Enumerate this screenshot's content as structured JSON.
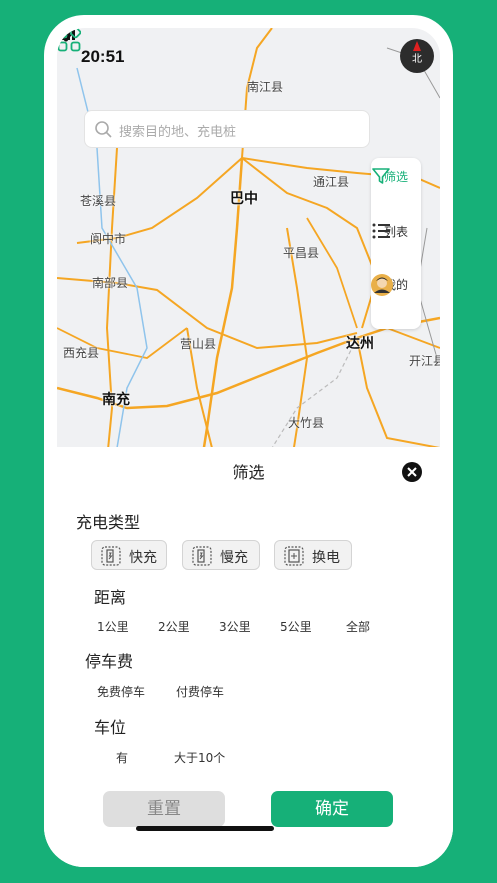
{
  "status_bar": {
    "time": "20:51"
  },
  "map": {
    "compass_label": "北",
    "places": {
      "nanjiang": "南江县",
      "cangxi": "苍溪县",
      "bazhong": "巴中",
      "tongjiang": "通江县",
      "langzhong": "阆中市",
      "pingchang": "平昌县",
      "nanbu": "南部县",
      "dazhou": "达州",
      "xichong": "西充县",
      "yingshan": "营山县",
      "kaijiang": "开江县",
      "nanchong": "南充",
      "dazhu": "大竹县"
    }
  },
  "search": {
    "placeholder": "搜索目的地、充电桩"
  },
  "side_panel": {
    "filter_label": "筛选",
    "list_label": "列表",
    "mine_label": "我的"
  },
  "filter_sheet": {
    "title": "筛选",
    "charge_type": {
      "title": "充电类型",
      "options": [
        "快充",
        "慢充",
        "换电"
      ]
    },
    "distance": {
      "title": "距离",
      "options": [
        "1公里",
        "2公里",
        "3公里",
        "5公里",
        "全部"
      ]
    },
    "parking_fee": {
      "title": "停车费",
      "options": [
        "免费停车",
        "付费停车"
      ]
    },
    "parking_space": {
      "title": "车位",
      "options": [
        "有",
        "大于10个"
      ]
    },
    "reset_label": "重置",
    "confirm_label": "确定"
  },
  "colors": {
    "brand": "#16b078",
    "road": "#f5a623"
  }
}
